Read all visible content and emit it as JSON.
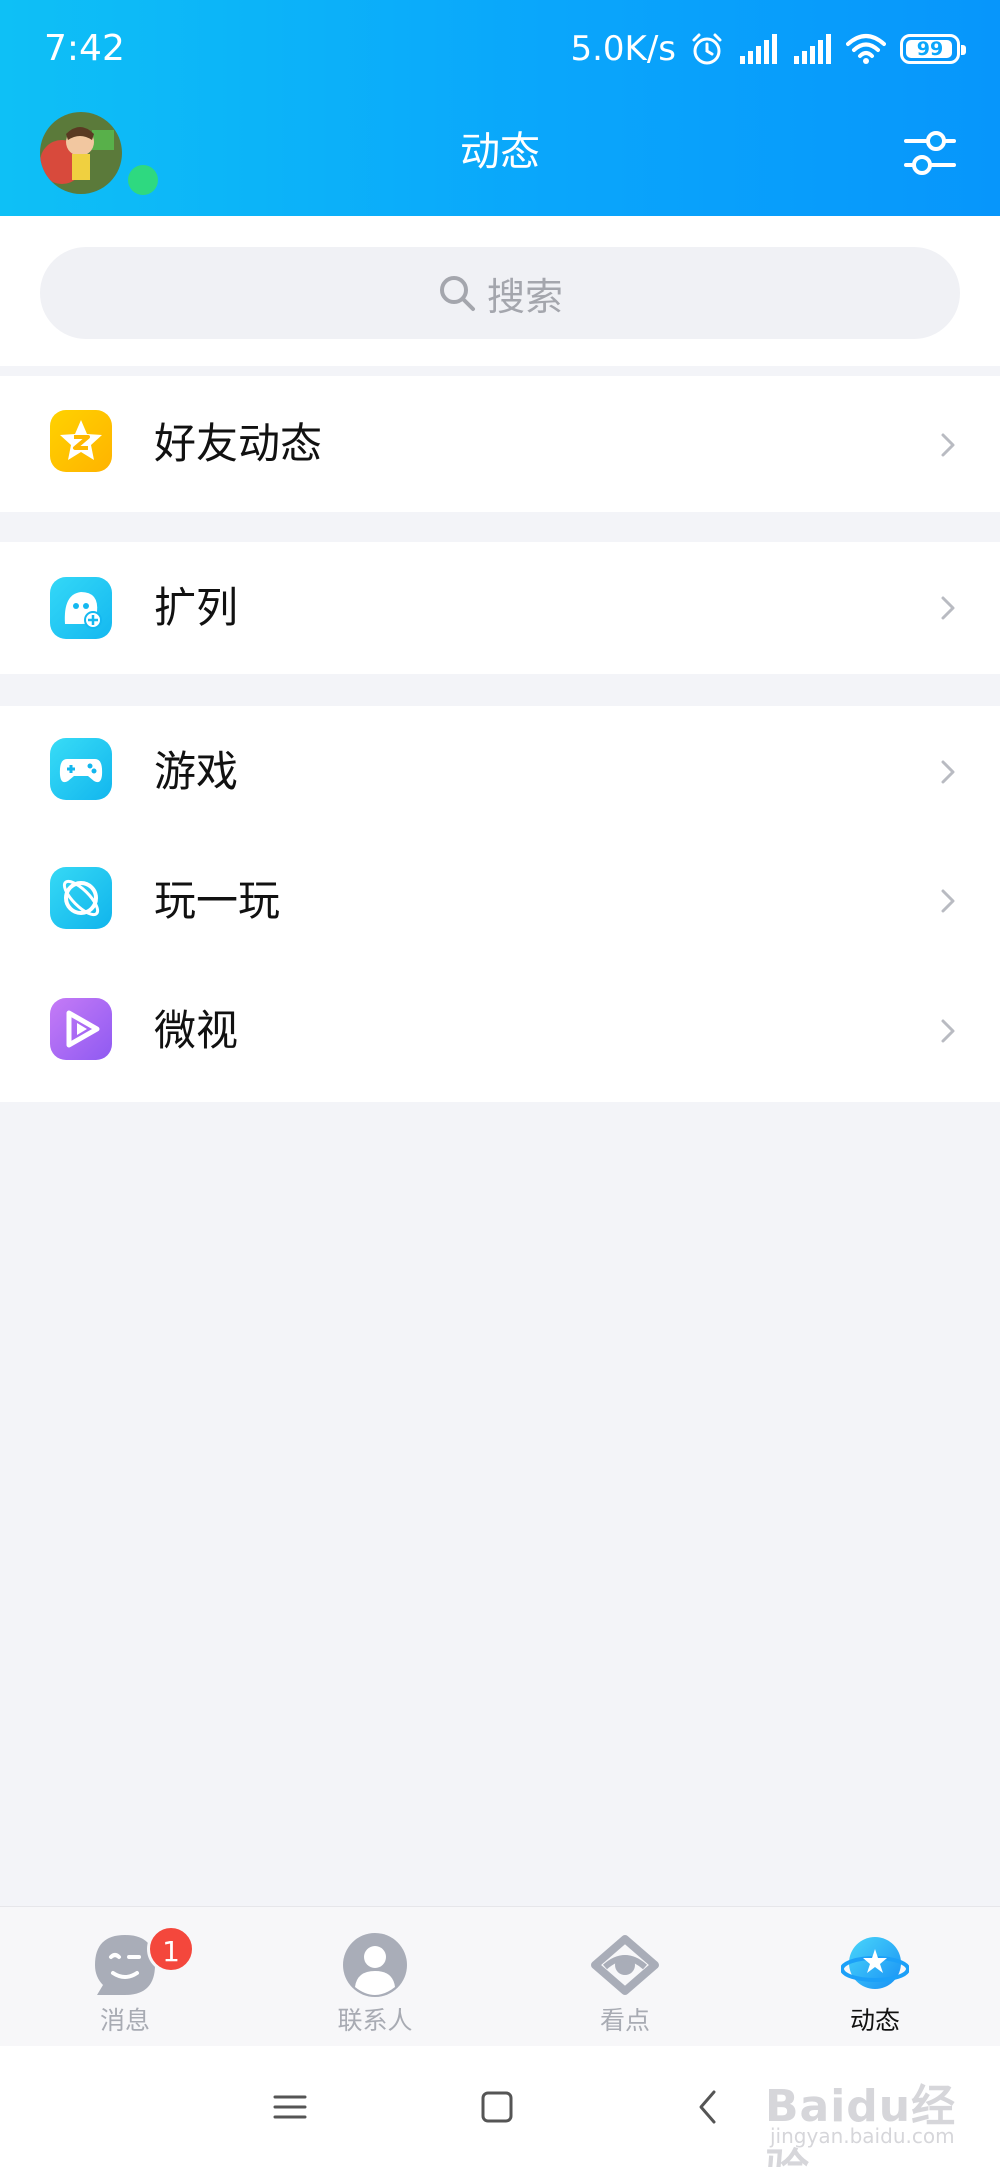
{
  "status_bar": {
    "time": "7:42",
    "net_speed": "5.0K/s",
    "battery": "99",
    "icons": [
      "alarm-icon",
      "signal-icon",
      "signal-icon",
      "wifi-icon",
      "battery-icon"
    ]
  },
  "header": {
    "title": "动态",
    "avatar": "avatar-image",
    "online": true,
    "settings_icon": "settings-sliders-icon"
  },
  "search": {
    "placeholder": "搜索",
    "icon": "search-icon"
  },
  "groups": [
    {
      "items": [
        {
          "label": "好友动态",
          "icon": "qzone-star-icon",
          "color": "#ffc400"
        }
      ]
    },
    {
      "items": [
        {
          "label": "扩列",
          "icon": "kuolie-face-icon",
          "color": "#24c9f5"
        }
      ]
    },
    {
      "items": [
        {
          "label": "游戏",
          "icon": "gamepad-icon",
          "color": "#22c6f1"
        },
        {
          "label": "玩一玩",
          "icon": "planet-ring-icon",
          "color": "#1cc9ef"
        },
        {
          "label": "微视",
          "icon": "weishi-play-icon",
          "color": "#a868f5"
        }
      ]
    }
  ],
  "tabbar": {
    "tabs": [
      {
        "label": "消息",
        "icon": "message-icon",
        "badge": "1",
        "active": false
      },
      {
        "label": "联系人",
        "icon": "contacts-icon",
        "active": false
      },
      {
        "label": "看点",
        "icon": "kandian-eye-icon",
        "active": false
      },
      {
        "label": "动态",
        "icon": "dongtai-planet-icon",
        "active": true
      }
    ]
  },
  "navbar": {
    "buttons": [
      "menu-icon",
      "home-icon",
      "back-icon"
    ]
  },
  "watermark": {
    "text": "Baidu经验",
    "sub": "jingyan.baidu.com"
  },
  "colors": {
    "header_start": "#0ec0f6",
    "header_end": "#0796fb",
    "background": "#f3f4f8",
    "badge": "#f4473c",
    "online": "#2ed980"
  }
}
